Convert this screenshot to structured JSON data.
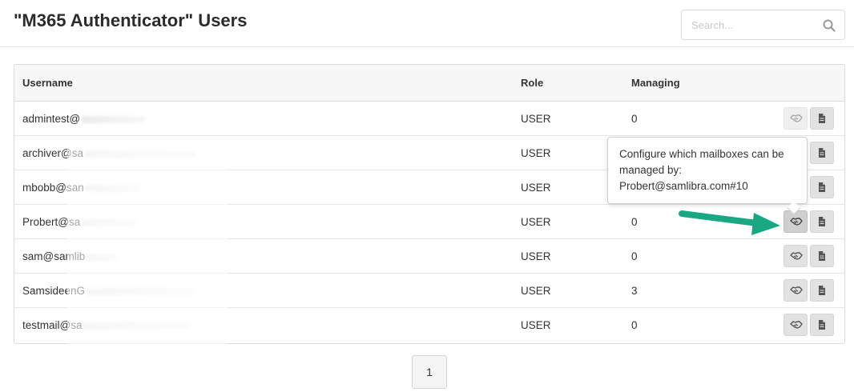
{
  "header": {
    "title": "\"M365 Authenticator\" Users",
    "search_placeholder": "Search..."
  },
  "table": {
    "columns": [
      "Username",
      "Role",
      "Managing"
    ],
    "rows": [
      {
        "username": "admintest@",
        "role": "USER",
        "managing": "0"
      },
      {
        "username": "archiver@sa",
        "role": "USER",
        "managing": ""
      },
      {
        "username": "mbobb@san",
        "role": "USER",
        "managing": ""
      },
      {
        "username": "Probert@sa",
        "role": "USER",
        "managing": "0"
      },
      {
        "username": "sam@samlib",
        "role": "USER",
        "managing": "0"
      },
      {
        "username": "SamsideenG",
        "role": "USER",
        "managing": "3"
      },
      {
        "username": "testmail@sa",
        "role": "USER",
        "managing": "0"
      }
    ]
  },
  "tooltip": {
    "line1": "Configure which mailboxes can be",
    "line2": "managed by:",
    "line3": "Probert@samlibra.com#10"
  },
  "pagination": {
    "current_page": "1"
  },
  "icons": {
    "search": "search-icon",
    "manage": "handshake-icon",
    "details": "document-icon",
    "annotation": "arrow-icon"
  },
  "colors": {
    "annotation_arrow": "#1aa882"
  }
}
